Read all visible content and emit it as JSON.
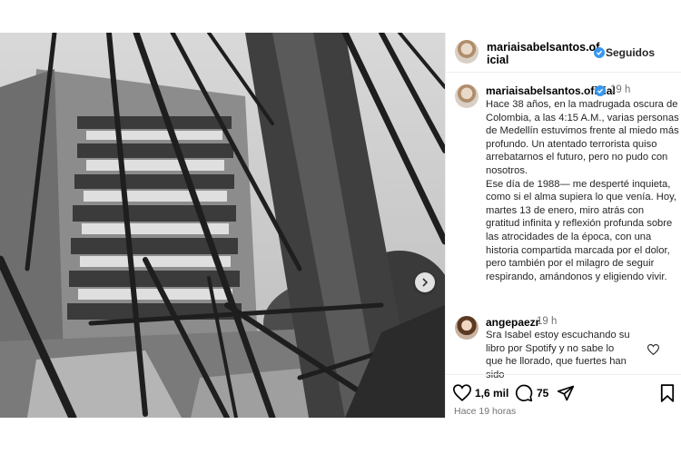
{
  "post": {
    "username": "mariaisabelsantos.oficial",
    "follow_status": "Seguidos",
    "caption": {
      "username": "mariaisabelsantos.oficial",
      "time": "19 h",
      "text": "Hace 38 años, en la madrugada oscura de Colombia, a las 4:15 A.M., varias personas de Medellín estuvimos frente al miedo más profundo. Un atentado terrorista quiso arrebatarnos el futuro, pero no pudo con nosotros.\nEse día de 1988— me desperté inquieta, como si el alma supiera lo que venía. Hoy, martes 13 de enero, miro atrás con gratitud infinita y reflexión profunda sobre las atrocidades de la época, con una historia compartida marcada por el dolor, pero también por el milagro de seguir respirando, amándonos y eligiendo vivir."
    },
    "comment": {
      "username": "angepaezr",
      "time": "19 h",
      "text": "Sra Isabel estoy escuchando su libro por Spotify y no sabe lo que he llorado, que fuertes han sido"
    },
    "actions": {
      "likes": "1,6 mil",
      "comments": "75"
    },
    "timestamp": "Hace 19 horas"
  },
  "icons": {
    "header_more": "more-options-icon",
    "verified": "verified-badge-icon",
    "next": "chevron-right-icon",
    "like": "heart-icon",
    "comment": "comment-bubble-icon",
    "share": "paper-plane-icon",
    "save": "bookmark-icon"
  },
  "colors": {
    "verified_blue": "#3897f0",
    "muted_text": "#737373"
  }
}
